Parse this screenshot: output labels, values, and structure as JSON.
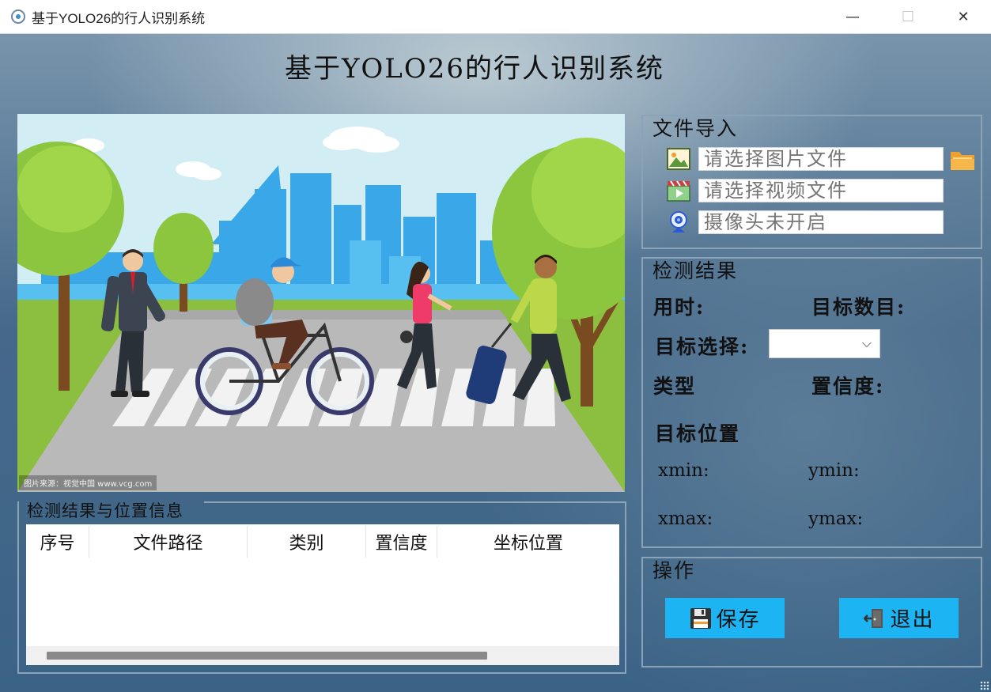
{
  "window": {
    "title": "基于YOLO26的行人识别系统",
    "minimize": "—",
    "maximize": "☐",
    "close": "✕"
  },
  "header": {
    "title": "基于YOLO26的行人识别系统"
  },
  "image": {
    "credit": "图片来源：视觉中国 www.vcg.com"
  },
  "table": {
    "title": "检测结果与位置信息",
    "columns": [
      "序号",
      "文件路径",
      "类别",
      "置信度",
      "坐标位置"
    ],
    "rows": []
  },
  "file_import": {
    "title": "文件导入",
    "image_placeholder": "请选择图片文件",
    "video_placeholder": "请选择视频文件",
    "camera_placeholder": "摄像头未开启",
    "icons": [
      "image-icon",
      "video-icon",
      "webcam-icon",
      "folder-icon"
    ]
  },
  "result": {
    "title": "检测结果",
    "time_label": "用时:",
    "count_label": "目标数目:",
    "select_label": "目标选择:",
    "select_value": "",
    "type_label": "类型",
    "conf_label": "置信度:",
    "position_label": "目标位置",
    "xmin_label": "xmin:",
    "ymin_label": "ymin:",
    "xmax_label": "xmax:",
    "ymax_label": "ymax:"
  },
  "operation": {
    "title": "操作",
    "save_label": "保存",
    "exit_label": "退出"
  },
  "colors": {
    "button": "#1cb4f2",
    "background": "#3b6386",
    "frame": "#8aa3b9"
  }
}
